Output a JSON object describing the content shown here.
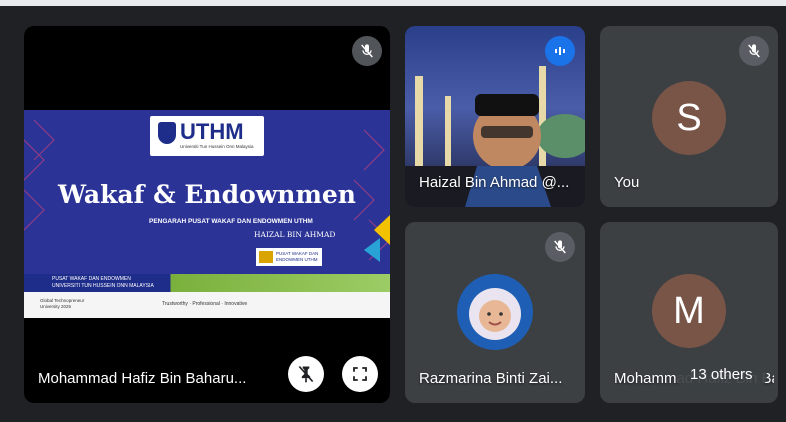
{
  "presenter": {
    "name": "Mohammad Hafiz Bin Baharu...",
    "slide": {
      "logo_text": "UTHM",
      "logo_sub": "Universiti Tun Hussein Onn Malaysia",
      "title": "Wakaf & Endownmen",
      "subtitle": "PENGARAH PUSAT WAKAF DAN ENDOWMEN UTHM",
      "presenter_line": "HAIZAL BIN AHMAD",
      "wakaf_badge_1": "PUSAT WAKAF DAN",
      "wakaf_badge_2": "ENDOWMEN UTHM",
      "banner_text_1": "PUSAT WAKAF DAN ENDOWMEN",
      "banner_text_2": "UNIVERSITI TUN HUSSEIN ONN MALAYSIA",
      "footer_left_1": "Global Technopreneur",
      "footer_left_2": "University 2025",
      "footer_center": "Trustworthy · Professional · Innovative"
    }
  },
  "tiles": {
    "haizal": {
      "name": "Haizal Bin Ahmad @..."
    },
    "you": {
      "name": "You",
      "initial": "S",
      "color": "#795548"
    },
    "razmarina": {
      "name": "Razmarina Binti Zai..."
    },
    "mohammad": {
      "name": "Mohammad Hafiz Bin Ba...",
      "initial": "M",
      "color": "#795548"
    },
    "others": {
      "label": "13 others"
    }
  }
}
